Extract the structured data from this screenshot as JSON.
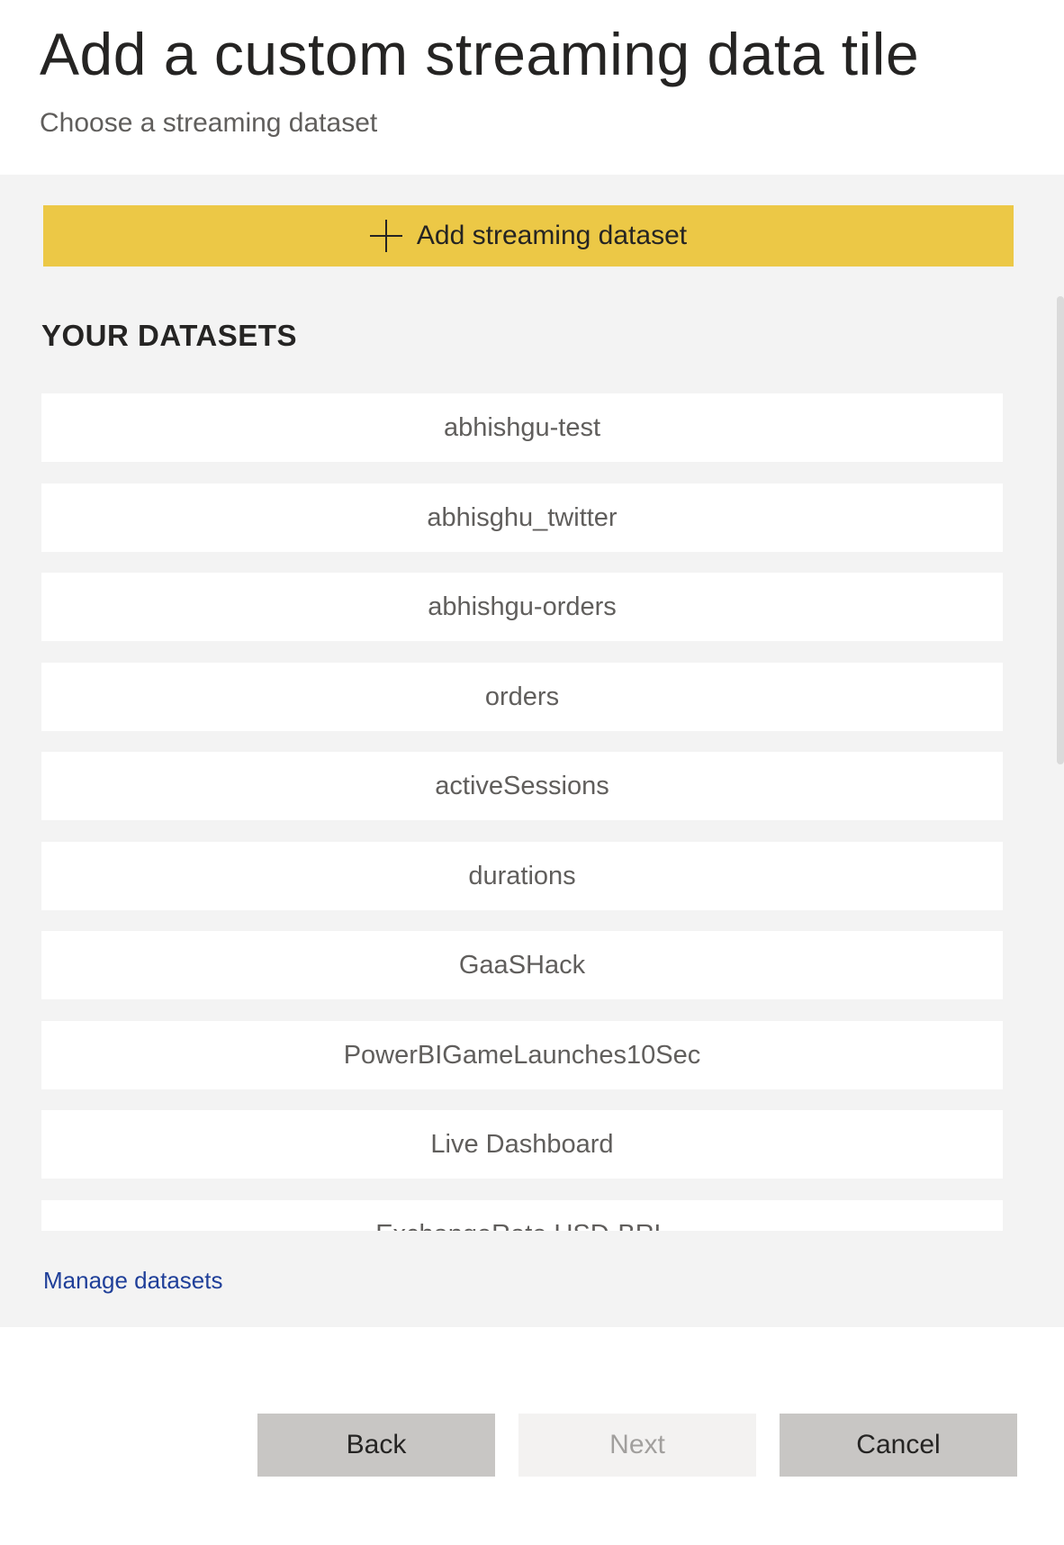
{
  "header": {
    "title": "Add a custom streaming data tile",
    "subtitle": "Choose a streaming dataset"
  },
  "panel": {
    "add_button_label": "Add streaming dataset",
    "add_button_icon": "plus-icon",
    "section_title": "YOUR DATASETS",
    "datasets": [
      "abhishgu-test",
      "abhisghu_twitter",
      "abhishgu-orders",
      "orders",
      "activeSessions",
      "durations",
      "GaaSHack",
      "PowerBIGameLaunches10Sec",
      "Live Dashboard",
      "ExchangeRate USD-BRL"
    ],
    "manage_link": "Manage datasets"
  },
  "footer": {
    "back_label": "Back",
    "next_label": "Next",
    "cancel_label": "Cancel"
  },
  "colors": {
    "accent_yellow": "#ecc846",
    "panel_bg": "#f3f3f3",
    "link_blue": "#1f3f99",
    "button_gray": "#c8c6c4"
  }
}
